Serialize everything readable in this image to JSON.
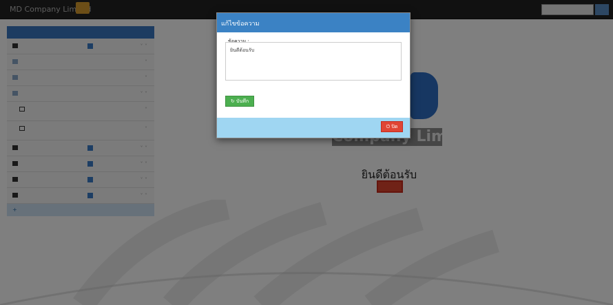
{
  "topbar": {
    "brand": "MD Company Limited",
    "user_link": "",
    "search_placeholder": ""
  },
  "sidebar": {
    "header": "",
    "items": [
      {
        "label": "",
        "type": "parent"
      },
      {
        "label": "",
        "type": "item"
      },
      {
        "label": "",
        "type": "item"
      },
      {
        "label": "",
        "type": "parent"
      },
      {
        "label": "",
        "type": "sub"
      },
      {
        "label": "",
        "type": "sub"
      },
      {
        "label": "",
        "type": "parent"
      },
      {
        "label": "",
        "type": "parent"
      },
      {
        "label": "",
        "type": "parent"
      },
      {
        "label": "",
        "type": "parent"
      }
    ],
    "footer": ""
  },
  "main": {
    "company_text": "Company Limited",
    "welcome": "ยินดีต้อนรับ",
    "edit_label": ""
  },
  "modal": {
    "title": "แก้ไขข้อความ",
    "field_label": "ข้อความ :",
    "message_value": "ยินดีต้อนรับ",
    "save_label": "บันทึก",
    "close_label": "ปิด"
  },
  "colors": {
    "accent_blue": "#3b82c4",
    "save_green": "#4caf50",
    "close_red": "#e04535",
    "footer_blue": "#9fd6f2"
  }
}
